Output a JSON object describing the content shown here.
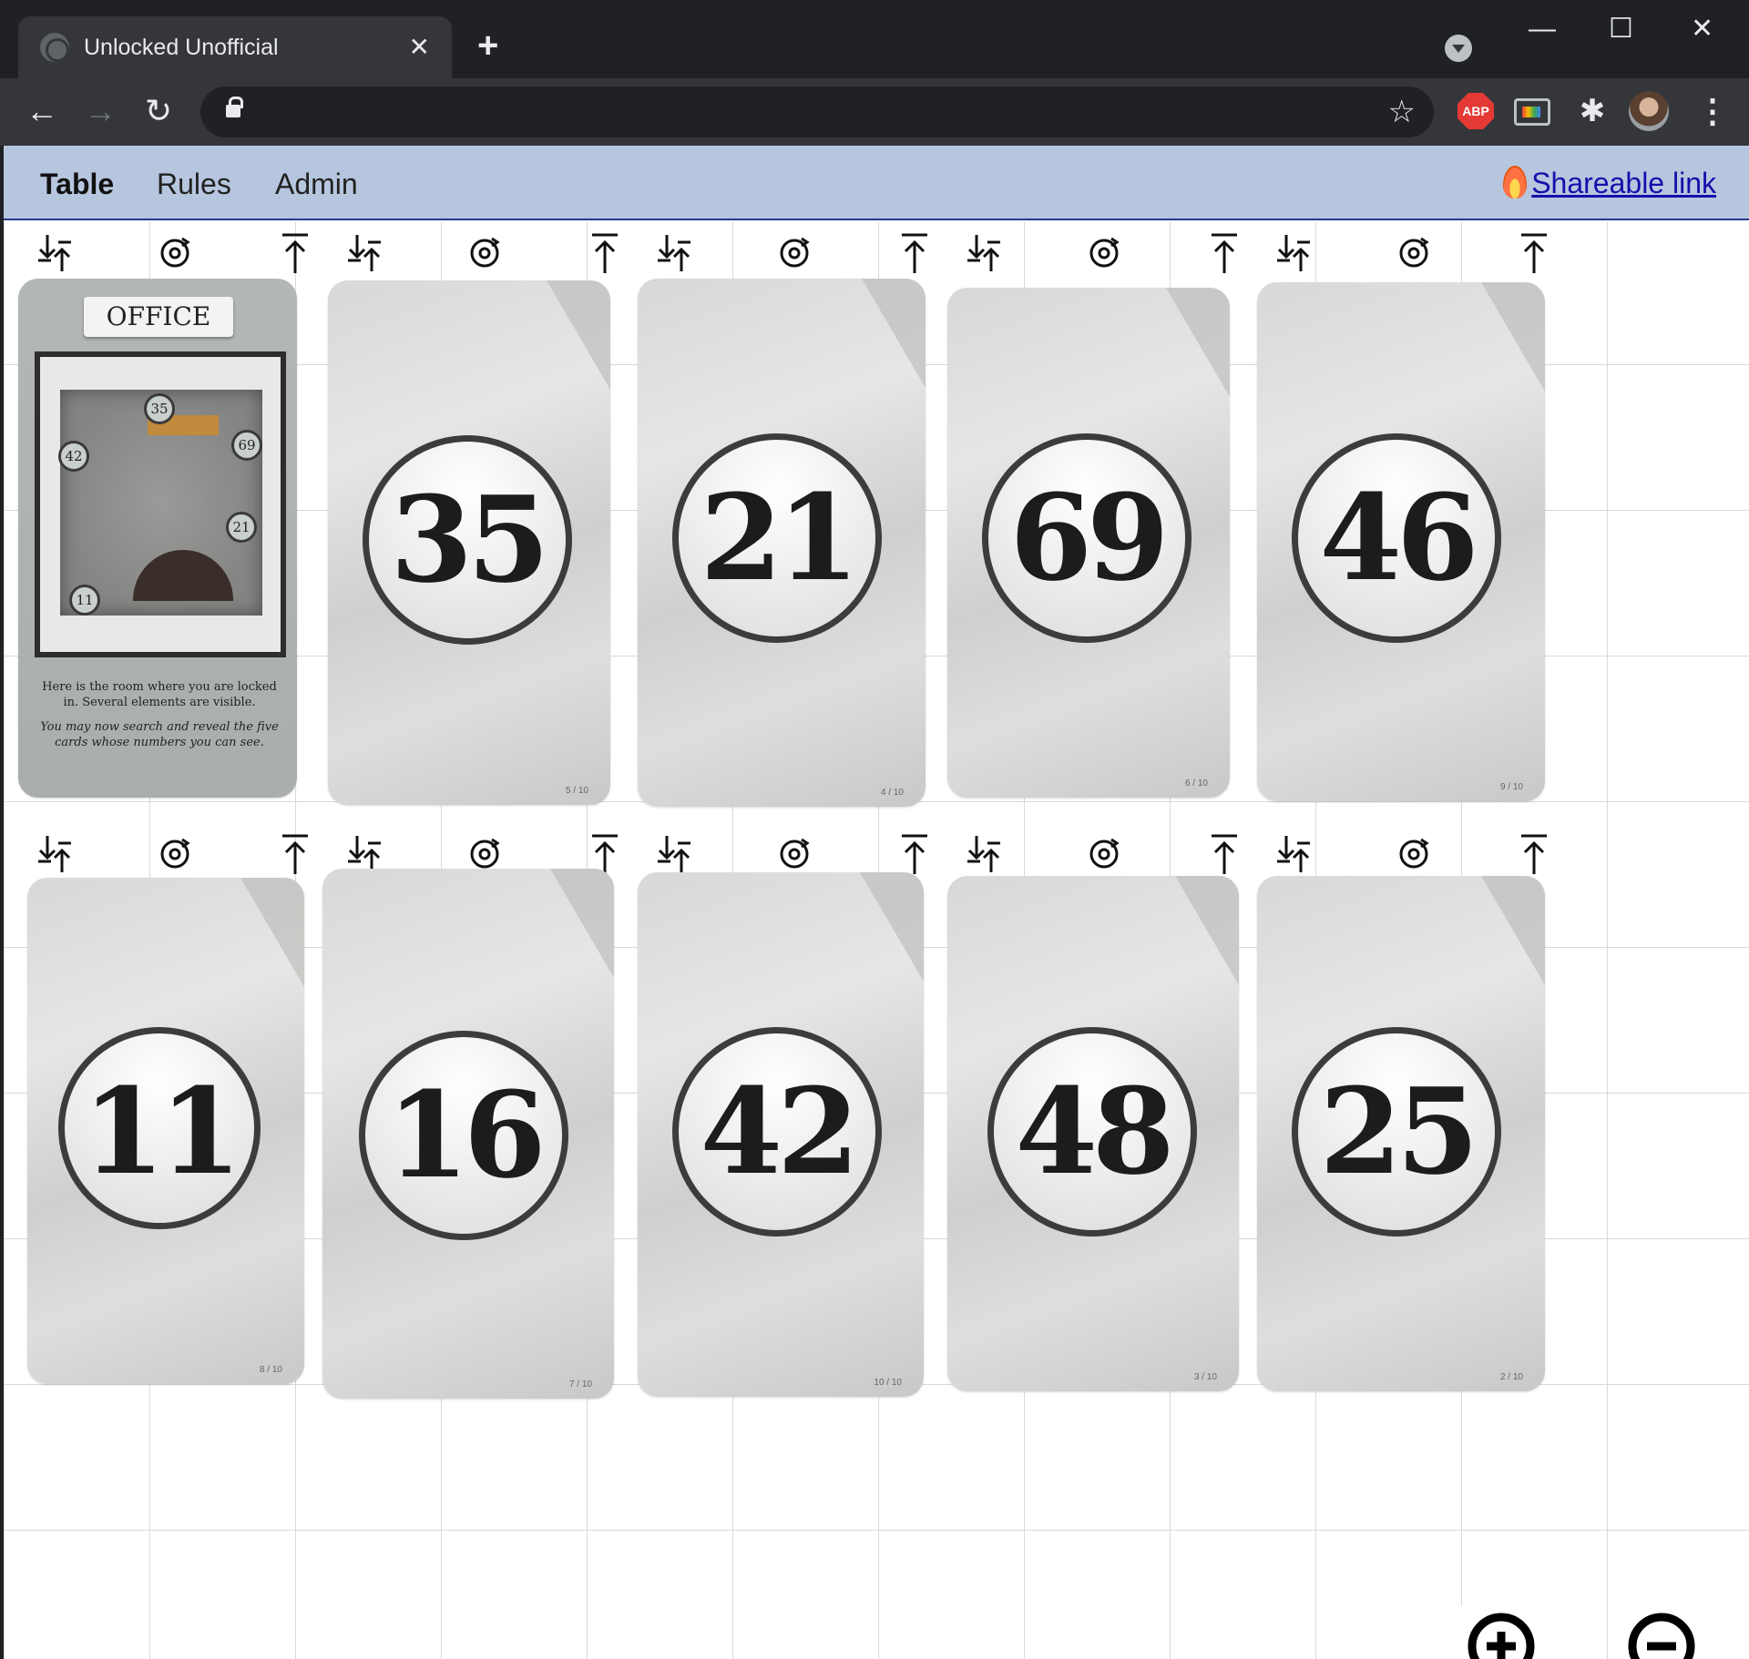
{
  "browser": {
    "tab_title": "Unlocked Unofficial",
    "tab_close": "✕",
    "new_tab": "+",
    "minimize": "—",
    "maximize": "☐",
    "close": "✕",
    "back": "←",
    "forward": "→",
    "reload": "↻",
    "star": "☆",
    "abp_label": "ABP",
    "puzzle": "✱",
    "menu": "⋮"
  },
  "nav": {
    "items": [
      {
        "label": "Table",
        "active": true
      },
      {
        "label": "Rules",
        "active": false
      },
      {
        "label": "Admin",
        "active": false
      }
    ],
    "share_label": "Shareable link"
  },
  "controls": {
    "flip_icon": "flip-icon",
    "rotate_icon": "rotate-icon",
    "top_icon": "move-to-top-icon"
  },
  "office_card": {
    "title": "OFFICE",
    "markers": [
      "35",
      "69",
      "42",
      "21",
      "11"
    ],
    "text": "Here is the room where you are locked in. Several elements are visible.",
    "text_italic": "You may now search and reveal the five cards whose numbers you can see."
  },
  "cards_row1": [
    {
      "number": "35",
      "index": "5 / 10"
    },
    {
      "number": "21",
      "index": "4 / 10"
    },
    {
      "number": "69",
      "index": "6 / 10"
    },
    {
      "number": "46",
      "index": "9 / 10"
    }
  ],
  "cards_row2": [
    {
      "number": "11",
      "index": "8 / 10"
    },
    {
      "number": "16",
      "index": "7 / 10"
    },
    {
      "number": "42",
      "index": "10 / 10"
    },
    {
      "number": "48",
      "index": "3 / 10"
    },
    {
      "number": "25",
      "index": "2 / 10"
    }
  ],
  "zoom": {
    "in_icon": "zoom-in-icon",
    "out_icon": "zoom-out-icon"
  }
}
